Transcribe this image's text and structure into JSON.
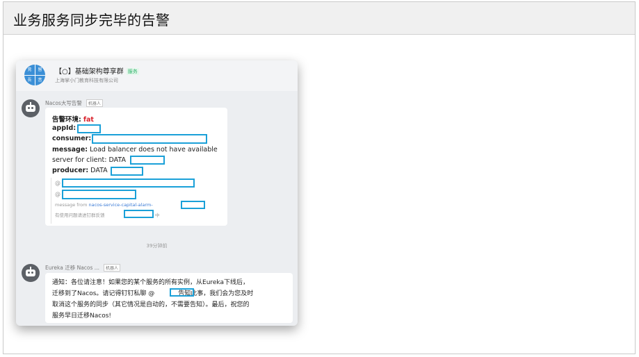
{
  "page": {
    "title": "业务服务同步完毕的告警"
  },
  "group": {
    "logo_chars": [
      "竞",
      "留",
      "吾",
      "音"
    ],
    "name": "【○】基础架构尊享群",
    "tag": "服务",
    "company": "上海掌小门教育科技有限公司"
  },
  "message1": {
    "sender": "Nacos大写告警",
    "sender_tag": "机器人",
    "env_label": "告警环境:",
    "env_value": "fat",
    "appid_label": "appId:",
    "consumer_label": "consumer:",
    "message_label": "message:",
    "message_text1": "Load balancer does not have available",
    "message_text2": "server for client: DATA",
    "producer_label": "producer:",
    "producer_text": "DATA",
    "at1": "@",
    "at2": "@",
    "from_prefix": "message from",
    "from_link": "nacos-service-capital-alarm-",
    "help_text": "有使用问题请进钉群反馈",
    "help_suffix": "中"
  },
  "timestamp": "39分钟前",
  "message2": {
    "sender": "Eureka 迁移 Nacos ...",
    "sender_tag": "机器人",
    "line1": "通知：各位请注意！如果您的某个服务的所有实例，从Eureka下线后，",
    "line2a": "迁移到了Nacos。请记得钉钉私聊 @",
    "line2b": "告知此事，我们会为您及时",
    "line3": "取消这个服务的同步（其它情况是自动的，不需要告知）。最后，祝您的",
    "line4": "服务早日迁移Nacos!"
  }
}
